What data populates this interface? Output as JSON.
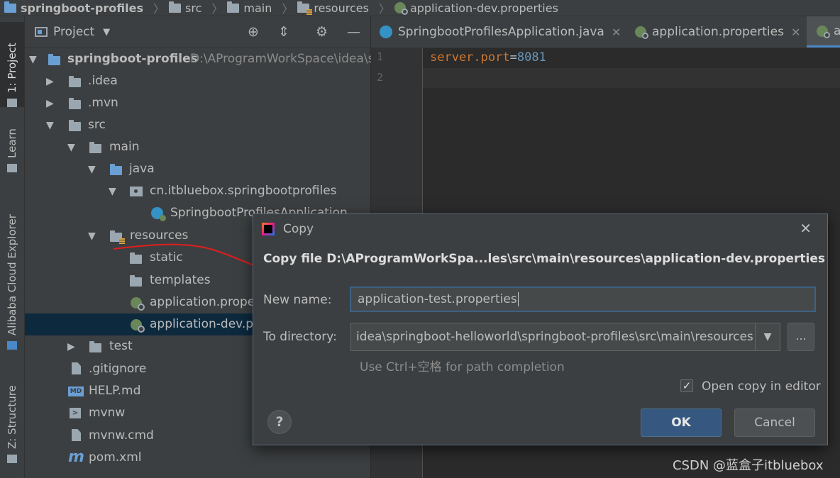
{
  "breadcrumb": [
    "springboot-profiles",
    "src",
    "main",
    "resources",
    "application-dev.properties"
  ],
  "left_stripe": {
    "tabs": [
      "1: Project",
      "Learn",
      "Alibaba Cloud Explorer",
      "Z: Structure"
    ]
  },
  "project_panel": {
    "title": "Project",
    "toolbar_icons": [
      "crosshair-icon",
      "collapse-icon",
      "gear-icon",
      "minimize-icon"
    ],
    "tree": [
      {
        "label": "springboot-profiles",
        "hint": "D:\\AProgramWorkSpace\\idea\\s",
        "icon": "module-folder-icon",
        "expanded": true
      },
      {
        "label": ".idea",
        "icon": "folder-icon",
        "expanded": false
      },
      {
        "label": ".mvn",
        "icon": "folder-icon",
        "expanded": false
      },
      {
        "label": "src",
        "icon": "folder-icon",
        "expanded": true
      },
      {
        "label": "main",
        "icon": "folder-icon",
        "expanded": true
      },
      {
        "label": "java",
        "icon": "source-folder-icon",
        "expanded": true
      },
      {
        "label": "cn.itbluebox.springbootprofiles",
        "icon": "package-icon",
        "expanded": true
      },
      {
        "label": "SpringbootProfilesApplication",
        "icon": "spring-boot-class-icon"
      },
      {
        "label": "resources",
        "icon": "resources-folder-icon",
        "expanded": true
      },
      {
        "label": "static",
        "icon": "folder-icon"
      },
      {
        "label": "templates",
        "icon": "folder-icon"
      },
      {
        "label": "application.prope",
        "icon": "spring-properties-icon"
      },
      {
        "label": "application-dev.p",
        "icon": "spring-properties-icon",
        "selected": true
      },
      {
        "label": "test",
        "icon": "folder-icon",
        "expanded": false
      },
      {
        "label": ".gitignore",
        "icon": "file-icon"
      },
      {
        "label": "HELP.md",
        "icon": "markdown-icon"
      },
      {
        "label": "mvnw",
        "icon": "terminal-file-icon"
      },
      {
        "label": "mvnw.cmd",
        "icon": "file-icon"
      },
      {
        "label": "pom.xml",
        "icon": "maven-icon"
      }
    ]
  },
  "editor": {
    "tabs": [
      {
        "label": "SpringbootProfilesApplication.java",
        "icon": "class-icon",
        "active": false
      },
      {
        "label": "application.properties",
        "icon": "spring-properties-icon",
        "active": false
      },
      {
        "label": "a",
        "icon": "spring-properties-icon",
        "active": true
      }
    ],
    "line_numbers": [
      "1",
      "2"
    ],
    "code": {
      "key": "server.port",
      "eq": "=",
      "value": "8081"
    }
  },
  "dialog": {
    "title": "Copy",
    "heading": "Copy file D:\\AProgramWorkSpa...les\\src\\main\\resources\\application-dev.properties",
    "new_name_label": "New name:",
    "new_name_value": "application-test.properties",
    "to_dir_label": "To directory:",
    "to_dir_value": "idea\\springboot-helloworld\\springboot-profiles\\src\\main\\resources",
    "browse_label": "...",
    "hint": "Use Ctrl+空格 for path completion",
    "open_in_editor_label": "Open copy in editor",
    "open_in_editor_checked": true,
    "ok_label": "OK",
    "cancel_label": "Cancel",
    "help_label": "?"
  },
  "watermark": "CSDN @蓝盒子itbluebox",
  "colors": {
    "annotation": "#e01e1e",
    "selection": "#0d293e",
    "ok_button": "#365880"
  }
}
